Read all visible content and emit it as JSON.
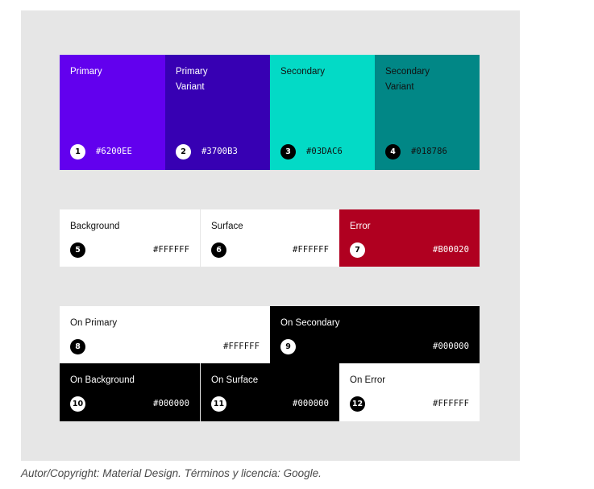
{
  "colors": {
    "primary": "#6200EE",
    "primary_variant": "#3700B3",
    "secondary": "#03DAC6",
    "secondary_variant": "#018786",
    "background": "#FFFFFF",
    "surface": "#FFFFFF",
    "error": "#B00020",
    "on_black": "#000000",
    "panel": "#E6E6E6"
  },
  "swatches": [
    {
      "num": "1",
      "name": "Primary",
      "hex": "#6200EE"
    },
    {
      "num": "2",
      "name": "Primary\nVariant",
      "hex": "#3700B3"
    },
    {
      "num": "3",
      "name": "Secondary",
      "hex": "#03DAC6"
    },
    {
      "num": "4",
      "name": "Secondary\nVariant",
      "hex": "#018786"
    },
    {
      "num": "5",
      "name": "Background",
      "hex": "#FFFFFF"
    },
    {
      "num": "6",
      "name": "Surface",
      "hex": "#FFFFFF"
    },
    {
      "num": "7",
      "name": "Error",
      "hex": "#B00020"
    },
    {
      "num": "8",
      "name": "On Primary",
      "hex": "#FFFFFF"
    },
    {
      "num": "9",
      "name": "On Secondary",
      "hex": "#000000"
    },
    {
      "num": "10",
      "name": "On Background",
      "hex": "#000000"
    },
    {
      "num": "11",
      "name": "On Surface",
      "hex": "#000000"
    },
    {
      "num": "12",
      "name": "On Error",
      "hex": "#FFFFFF"
    }
  ],
  "caption": "Autor/Copyright: Material Design. Términos y licencia: Google."
}
